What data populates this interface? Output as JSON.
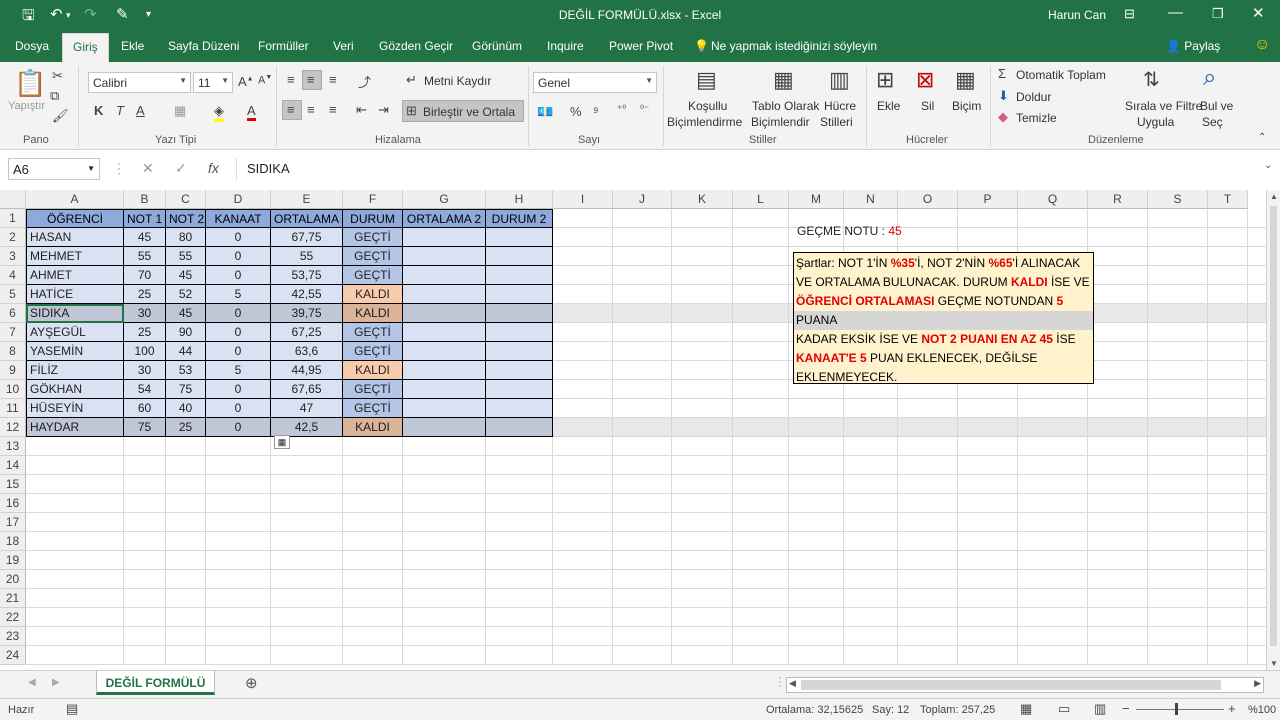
{
  "titlebar": {
    "title": "DEĞİL FORMÜLÜ.xlsx - Excel",
    "user": "Harun Can"
  },
  "tabs": [
    "Dosya",
    "Giriş",
    "Ekle",
    "Sayfa Düzeni",
    "Formüller",
    "Veri",
    "Gözden Geçir",
    "Görünüm",
    "Inquire",
    "Power Pivot"
  ],
  "tell_me": "Ne yapmak istediğinizi söyleyin",
  "share": "Paylaş",
  "ribbon": {
    "paste": "Yapıştır",
    "font_name": "Calibri",
    "font_size": "11",
    "wrap_text": "Metni Kaydır",
    "merge_center": "Birleştir ve Ortala",
    "number_format": "Genel",
    "cond_format_1": "Koşullu",
    "cond_format_2": "Biçimlendirme",
    "table_format_1": "Tablo Olarak",
    "table_format_2": "Biçimlendir",
    "cell_styles_1": "Hücre",
    "cell_styles_2": "Stilleri",
    "insert": "Ekle",
    "delete": "Sil",
    "format": "Biçim",
    "autosum": "Otomatik Toplam",
    "fill": "Doldur",
    "clear": "Temizle",
    "sort_1": "Sırala ve Filtre",
    "sort_2": "Uygula",
    "find_1": "Bul ve",
    "find_2": "Seç",
    "groups": {
      "clipboard": "Pano",
      "font": "Yazı Tipi",
      "alignment": "Hizalama",
      "number": "Sayı",
      "styles": "Stiller",
      "cells": "Hücreler",
      "editing": "Düzenleme"
    }
  },
  "formula_bar": {
    "name_box": "A6",
    "content": "SIDIKA"
  },
  "columns": [
    "A",
    "B",
    "C",
    "D",
    "E",
    "F",
    "G",
    "H",
    "I",
    "J",
    "K",
    "L",
    "M",
    "N",
    "O",
    "P",
    "Q",
    "R",
    "S",
    "T"
  ],
  "rows": [
    "1",
    "2",
    "3",
    "4",
    "5",
    "6",
    "7",
    "8",
    "9",
    "10",
    "11",
    "12",
    "13",
    "14",
    "15",
    "16",
    "17",
    "18",
    "19",
    "20",
    "21",
    "22",
    "23",
    "24"
  ],
  "table": {
    "headers": [
      "ÖĞRENCİ",
      "NOT 1",
      "NOT 2",
      "KANAAT",
      "ORTALAMA",
      "DURUM",
      "ORTALAMA 2",
      "DURUM 2"
    ],
    "rows": [
      [
        "HASAN",
        "45",
        "80",
        "0",
        "67,75",
        "GEÇTİ"
      ],
      [
        "MEHMET",
        "55",
        "55",
        "0",
        "55",
        "GEÇTİ"
      ],
      [
        "AHMET",
        "70",
        "45",
        "0",
        "53,75",
        "GEÇTİ"
      ],
      [
        "HATİCE",
        "25",
        "52",
        "5",
        "42,55",
        "KALDI"
      ],
      [
        "SIDIKA",
        "30",
        "45",
        "0",
        "39,75",
        "KALDI"
      ],
      [
        "AYŞEGÜL",
        "25",
        "90",
        "0",
        "67,25",
        "GEÇTİ"
      ],
      [
        "YASEMİN",
        "100",
        "44",
        "0",
        "63,6",
        "GEÇTİ"
      ],
      [
        "FİLİZ",
        "30",
        "53",
        "5",
        "44,95",
        "KALDI"
      ],
      [
        "GÖKHAN",
        "54",
        "75",
        "0",
        "67,65",
        "GEÇTİ"
      ],
      [
        "HÜSEYİN",
        "60",
        "40",
        "0",
        "47",
        "GEÇTİ"
      ],
      [
        "HAYDAR",
        "75",
        "25",
        "0",
        "42,5",
        "KALDI"
      ]
    ]
  },
  "pass_grade": {
    "label": "GEÇME NOTU :",
    "value": "45"
  },
  "note": {
    "l1a": "Şartlar: NOT 1'İN ",
    "l1b": "%35",
    "l1c": "'İ, NOT 2'NİN ",
    "l1d": "%65",
    "l1e": "'İ ALINACAK",
    "l2a": "VE ORTALAMA BULUNACAK. DURUM ",
    "l2b": "KALDI",
    "l2c": " İSE VE",
    "l3a": "ÖĞRENCİ ORTALAMASI",
    "l3b": " GEÇME NOTUNDAN ",
    "l3c": "5",
    "l4": "PUANA",
    "l5a": "KADAR EKSİK İSE VE ",
    "l5b": "NOT 2 PUANI EN AZ 45",
    "l5c": " İSE",
    "l6a": "KANAAT'E 5",
    "l6b": " PUAN EKLENECEK, DEĞİLSE",
    "l7": "EKLENMEYECEK."
  },
  "sheet_tab": "DEĞİL FORMÜLÜ",
  "status": {
    "ready": "Hazır",
    "average": "Ortalama: 32,15625",
    "count": "Say: 12",
    "sum": "Toplam: 257,25",
    "zoom": "%100"
  },
  "colors": {
    "excel_green": "#217346",
    "header_blue": "#8eaadb",
    "pass": "#b4c6e7",
    "fail": "#f8cbad",
    "note_bg": "#fff2cc"
  }
}
